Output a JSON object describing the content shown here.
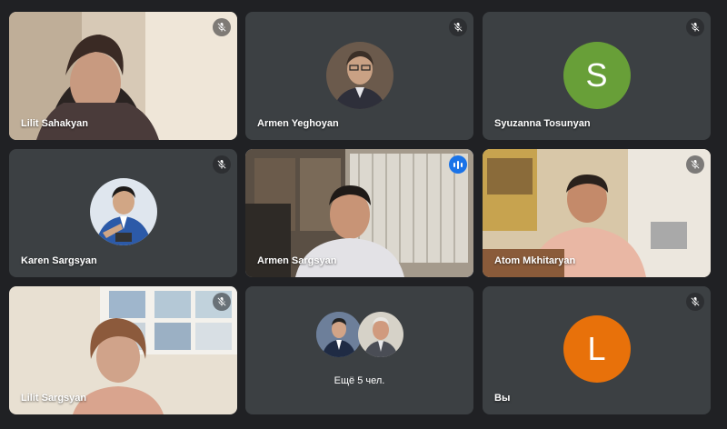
{
  "meeting": {
    "participants": [
      {
        "name": "Lilit Sahakyan",
        "muted": true,
        "type": "video"
      },
      {
        "name": "Armen Yeghoyan",
        "muted": true,
        "type": "photo"
      },
      {
        "name": "Syuzanna Tosunyan",
        "muted": true,
        "type": "initial",
        "initial": "S",
        "color": "#689f38"
      },
      {
        "name": "Karen Sargsyan",
        "muted": true,
        "type": "photo"
      },
      {
        "name": "Armen Sargsyan",
        "muted": false,
        "speaking": true,
        "type": "video"
      },
      {
        "name": "Atom Mkhitaryan",
        "muted": true,
        "type": "video"
      },
      {
        "name": "Lilit Sargsyan",
        "muted": true,
        "type": "video"
      },
      {
        "name": "",
        "type": "more",
        "more_label": "Ещё 5 чел."
      },
      {
        "name": "Вы",
        "muted": true,
        "type": "initial",
        "initial": "L",
        "color": "#e8710a"
      }
    ]
  },
  "colors": {
    "background": "#202124",
    "tile": "#3c4043",
    "active_border": "#8ab4f8",
    "speaking_indicator": "#1a73e8"
  },
  "icons": {
    "mute": "mic-off-icon",
    "speaking": "audio-level-icon"
  }
}
